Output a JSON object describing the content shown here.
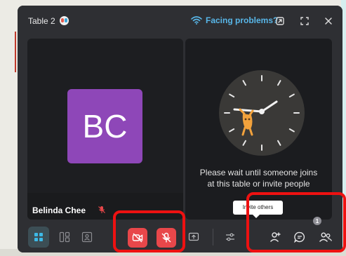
{
  "window": {
    "title": "Table 2",
    "facing_problems": "Facing problems?"
  },
  "participants": [
    {
      "initials": "BC",
      "name": "Belinda Chee",
      "avatar_color": "#8e47b8"
    }
  ],
  "waiting_message": {
    "line1": "Please wait until someone joins",
    "line2": "at this table or invite people"
  },
  "toolbar": {
    "tooltip": "Invite others",
    "people_count": "1"
  },
  "colors": {
    "accent_link": "#58b6e8",
    "mute_red": "#e8474a",
    "highlight_red": "#ee1111",
    "window_bg": "#2e2f33"
  },
  "icons": [
    "wifi-icon",
    "popout-icon",
    "fullscreen-icon",
    "close-icon",
    "grid-view-icon",
    "split-view-icon",
    "speaker-view-icon",
    "video-off-icon",
    "mic-off-icon",
    "share-screen-icon",
    "settings-sliders-icon",
    "invite-person-icon",
    "chat-icon",
    "people-icon"
  ]
}
